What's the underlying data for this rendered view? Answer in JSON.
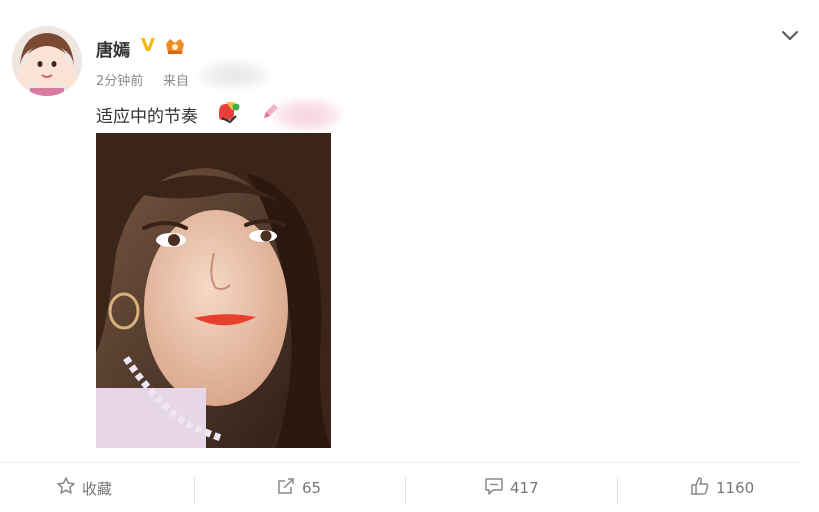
{
  "post": {
    "author": "唐嫣",
    "verified_mark": "V",
    "time": "2分钟前",
    "source_prefix": "来自",
    "text": "适应中的节奏",
    "icons": [
      "avatar",
      "verified-badge",
      "member-crown-icon",
      "chevron-down-icon",
      "hand-emoji-icon",
      "pen-emoji-icon"
    ]
  },
  "actions": {
    "favorite_label": "收藏",
    "repost_count": "65",
    "comment_count": "417",
    "like_count": "1160",
    "icons": [
      "star-icon",
      "share-icon",
      "comment-icon",
      "thumbs-up-icon"
    ]
  },
  "colors": {
    "name": "#333333",
    "meta": "#8a8a8a",
    "verified": "#f6b700",
    "action_text": "#777777",
    "divider": "#ececec"
  }
}
